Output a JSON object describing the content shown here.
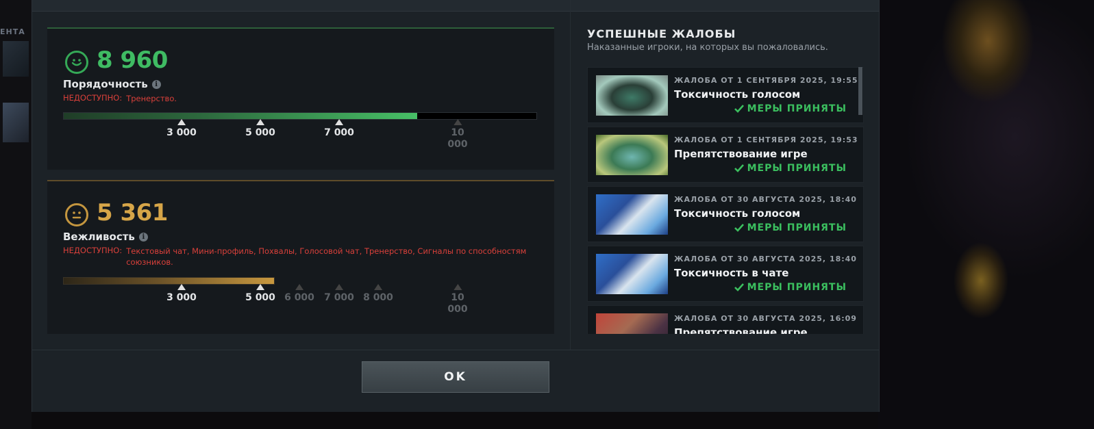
{
  "background": {
    "left_label": "ЕНТА"
  },
  "conduct": {
    "score": "8 960",
    "title": "Порядочность",
    "unavailable_label": "НЕДОСТУПНО:",
    "unavailable_items": "Тренерство.",
    "progress_fraction": 0.748,
    "ticks": [
      {
        "label": "3 000",
        "active": true
      },
      {
        "label": "5 000",
        "active": true
      },
      {
        "label": "7 000",
        "active": true
      },
      {
        "label": "10\n000",
        "active": false
      }
    ]
  },
  "politeness": {
    "score": "5 361",
    "title": "Вежливость",
    "unavailable_label": "НЕДОСТУПНО:",
    "unavailable_items": "Текстовый чат, Мини-профиль, Похвалы, Голосовой чат, Тренерство, Сигналы по способностям союзников.",
    "progress_fraction": 0.446,
    "ticks": [
      {
        "label": "3 000",
        "active": true
      },
      {
        "label": "5 000",
        "active": true
      },
      {
        "label": "6 000",
        "active": false
      },
      {
        "label": "7 000",
        "active": false
      },
      {
        "label": "8 000",
        "active": false
      },
      {
        "label": "10\n000",
        "active": false
      }
    ]
  },
  "reports_panel": {
    "title": "УСПЕШНЫЕ ЖАЛОБЫ",
    "subtitle": "Наказанные игроки, на которых вы пожаловались.",
    "items": [
      {
        "header": "ЖАЛОБА ОТ 1 СЕНТЯБРЯ 2025, 19:55",
        "reason": "Токсичность голосом",
        "status": "МЕРЫ ПРИНЯТЫ"
      },
      {
        "header": "ЖАЛОБА ОТ 1 СЕНТЯБРЯ 2025, 19:53",
        "reason": "Препятствование игре",
        "status": "МЕРЫ ПРИНЯТЫ"
      },
      {
        "header": "ЖАЛОБА ОТ 30 АВГУСТА 2025, 18:40",
        "reason": "Токсичность голосом",
        "status": "МЕРЫ ПРИНЯТЫ"
      },
      {
        "header": "ЖАЛОБА ОТ 30 АВГУСТА 2025, 18:40",
        "reason": "Токсичность в чате",
        "status": "МЕРЫ ПРИНЯТЫ"
      },
      {
        "header": "ЖАЛОБА ОТ 30 АВГУСТА 2025, 16:09",
        "reason": "Препятствование игре",
        "status": ""
      }
    ]
  },
  "footer": {
    "ok_label": "OK"
  },
  "colors": {
    "green": "#3fbb63",
    "gold": "#d6a548",
    "error": "#d9403a",
    "success": "#3bbf5f"
  }
}
